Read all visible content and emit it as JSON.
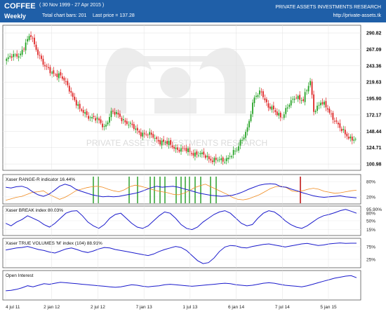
{
  "header": {
    "symbol": "COFFEE",
    "frequency": "Weekly",
    "period": "( 30 Nov 1999 - 27 Apr 2015 )",
    "total_bars": "Total chart bars: 201",
    "last_price": "Last price = 137.28",
    "organization": "PRIVATE ASSETS INVESTMENTS RESEARCH",
    "url": "http://private-assets.tk"
  },
  "watermark": "PRIVATE ASSETS INVESTMENTS RESEARCH",
  "colors": {
    "header_bg": "#1f5fa8",
    "up_candle": "#1fa01f",
    "down_candle": "#dd1f1f",
    "indicator_line": "#1a1acc",
    "range_r_orange": "#f08a1e",
    "signal_green": "#1f9a1f",
    "signal_red": "#c01818"
  },
  "chart_data": [
    {
      "type": "candlestick",
      "title": "COFFEE Weekly",
      "price_ticks": [
        "290.82",
        "267.09",
        "243.36",
        "219.63",
        "195.90",
        "172.17",
        "148.44",
        "124.71",
        "100.98"
      ],
      "ylim": [
        95,
        298
      ],
      "time_ticks": [
        "4 jul 11",
        "2 jan 12",
        "2 jul 12",
        "7 jan 13",
        "1 jul 13",
        "6 jan 14",
        "7 jul 14",
        "5 jan 15"
      ],
      "last_price": 137.28,
      "approx_close_path": [
        {
          "week": 0,
          "close": 252
        },
        {
          "week": 8,
          "close": 262
        },
        {
          "week": 14,
          "close": 287
        },
        {
          "week": 22,
          "close": 240
        },
        {
          "week": 30,
          "close": 230
        },
        {
          "week": 36,
          "close": 211
        },
        {
          "week": 42,
          "close": 178
        },
        {
          "week": 50,
          "close": 168
        },
        {
          "week": 56,
          "close": 155
        },
        {
          "week": 60,
          "close": 176
        },
        {
          "week": 66,
          "close": 168
        },
        {
          "week": 74,
          "close": 150
        },
        {
          "week": 84,
          "close": 140
        },
        {
          "week": 92,
          "close": 130
        },
        {
          "week": 100,
          "close": 122
        },
        {
          "week": 108,
          "close": 117
        },
        {
          "week": 116,
          "close": 110
        },
        {
          "week": 124,
          "close": 104
        },
        {
          "week": 128,
          "close": 115
        },
        {
          "week": 132,
          "close": 120
        },
        {
          "week": 138,
          "close": 155
        },
        {
          "week": 142,
          "close": 195
        },
        {
          "week": 146,
          "close": 208
        },
        {
          "week": 150,
          "close": 183
        },
        {
          "week": 154,
          "close": 176
        },
        {
          "week": 158,
          "close": 171
        },
        {
          "week": 162,
          "close": 186
        },
        {
          "week": 166,
          "close": 201
        },
        {
          "week": 170,
          "close": 193
        },
        {
          "week": 174,
          "close": 220
        },
        {
          "week": 176,
          "close": 180
        },
        {
          "week": 180,
          "close": 190
        },
        {
          "week": 184,
          "close": 180
        },
        {
          "week": 188,
          "close": 166
        },
        {
          "week": 192,
          "close": 148
        },
        {
          "week": 196,
          "close": 141
        },
        {
          "week": 200,
          "close": 137.28
        }
      ]
    },
    {
      "type": "line",
      "title": "Xaser RANGE-R indicator  16.44%",
      "yticks": [
        "80%",
        "20%"
      ],
      "ylim": [
        0,
        100
      ],
      "series": [
        {
          "name": "RANGE-R",
          "values": [
            58,
            55,
            60,
            62,
            55,
            40,
            28,
            22,
            30,
            45,
            62,
            70,
            64,
            50,
            42,
            35,
            28,
            24,
            20,
            22,
            20,
            22,
            26,
            30,
            34,
            40,
            48,
            56,
            62,
            58,
            60,
            62,
            58,
            52,
            46,
            40,
            34,
            30,
            26,
            24,
            22,
            24,
            26,
            32,
            40,
            50,
            58,
            66,
            70,
            72,
            70,
            60,
            58,
            50,
            44,
            36,
            30,
            24,
            20,
            18,
            20,
            22,
            24,
            20,
            18,
            16
          ]
        },
        {
          "values": [
            6,
            12,
            18,
            22,
            30,
            38,
            40,
            44,
            30,
            20,
            10,
            18,
            30,
            44,
            50,
            56,
            60,
            62,
            58,
            50,
            44,
            40,
            48,
            60,
            66,
            62,
            56,
            50,
            44,
            40,
            36,
            30,
            28,
            34,
            44,
            56,
            64,
            70,
            60,
            50,
            40,
            30,
            18,
            10,
            8,
            12,
            20,
            28,
            40,
            52,
            60,
            62,
            56,
            44,
            40,
            44,
            50,
            54,
            50,
            42,
            38,
            34,
            36,
            40,
            44,
            46
          ]
        }
      ]
    },
    {
      "type": "line",
      "title": "Xaser BREAK index  80.03%",
      "yticks": [
        "95.90%",
        "80%",
        "50%",
        "15%"
      ],
      "ylim": [
        0,
        100
      ],
      "series": [
        {
          "name": "BREAK index",
          "values": [
            40,
            30,
            45,
            55,
            70,
            60,
            50,
            35,
            25,
            40,
            60,
            80,
            88,
            90,
            70,
            45,
            30,
            20,
            35,
            60,
            75,
            80,
            60,
            40,
            25,
            20,
            30,
            50,
            70,
            85,
            80,
            60,
            35,
            20,
            15,
            25,
            45,
            60,
            75,
            85,
            90,
            80,
            60,
            40,
            30,
            35,
            60,
            80,
            90,
            85,
            70,
            50,
            35,
            25,
            20,
            30,
            45,
            60,
            70,
            75,
            82,
            90,
            95,
            88,
            80
          ]
        }
      ]
    },
    {
      "type": "line",
      "title": "Xaser TRUE VOLUMES 'M' index (104)  88.91%",
      "yticks": [
        "75%",
        "25%"
      ],
      "ylim": [
        0,
        100
      ],
      "series": [
        {
          "name": "TRUE VOLUMES 'M'",
          "values": [
            62,
            66,
            70,
            72,
            76,
            70,
            64,
            60,
            54,
            50,
            58,
            66,
            70,
            64,
            56,
            52,
            58,
            66,
            72,
            70,
            64,
            60,
            56,
            52,
            48,
            44,
            40,
            46,
            56,
            64,
            70,
            76,
            72,
            60,
            40,
            20,
            8,
            12,
            30,
            56,
            74,
            80,
            78,
            72,
            70,
            76,
            80,
            84,
            86,
            82,
            78,
            74,
            78,
            82,
            86,
            88,
            84,
            80,
            82,
            86,
            88,
            90,
            88,
            89,
            88.91
          ]
        }
      ]
    },
    {
      "type": "area",
      "title": "Open Interest",
      "series": [
        {
          "name": "Open Interest",
          "values": [
            28,
            30,
            34,
            40,
            48,
            44,
            50,
            56,
            54,
            58,
            62,
            60,
            58,
            56,
            54,
            52,
            50,
            48,
            46,
            44,
            42,
            44,
            48,
            52,
            50,
            46,
            44,
            46,
            48,
            52,
            54,
            52,
            50,
            48,
            46,
            48,
            50,
            52,
            54,
            56,
            58,
            56,
            52,
            50,
            48,
            50,
            54,
            58,
            60,
            58,
            54,
            50,
            48,
            46,
            44,
            48,
            54,
            60,
            66,
            72,
            78,
            82,
            86,
            88,
            80
          ]
        }
      ]
    }
  ],
  "panels": {
    "range_r_label": "Xaser RANGE-R indicator  16.44%",
    "break_label": "Xaser BREAK index  80.03%",
    "volumes_label": "Xaser TRUE VOLUMES 'M' index (104)  88.91%",
    "oi_label": "Open Interest"
  }
}
